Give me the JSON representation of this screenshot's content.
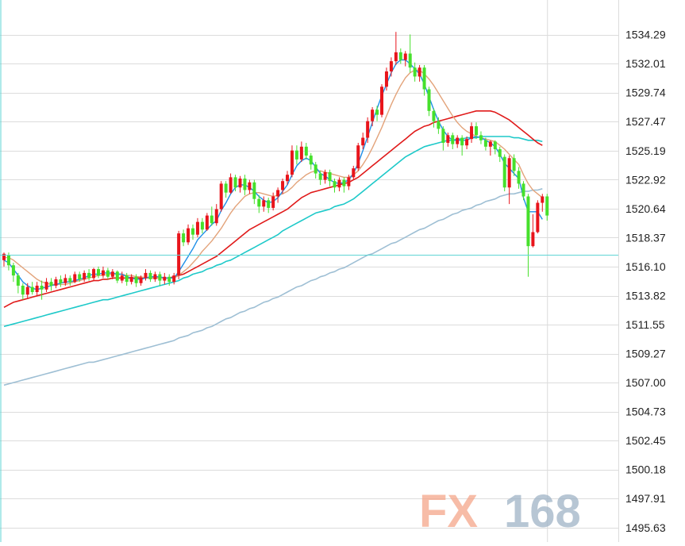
{
  "watermark": {
    "fx": "FX",
    "num": "168"
  },
  "colors": {
    "background": "#ffffff",
    "grid": "#dcdcdc",
    "axis_panel": "#ffffff",
    "up_candle": "#e8141b",
    "down_candle": "#46e02c",
    "ma_fast": "#1e8fe8",
    "ma_slow": "#e3a37a",
    "ma_mid": "#e01a1a",
    "ma_long": "#1ec9c9",
    "ma_longest": "#9ebfd4",
    "price_line": "#5fd5d5"
  },
  "chart_data": {
    "type": "candlestick",
    "title": "",
    "xlabel": "",
    "ylabel": "",
    "ylim": [
      1494.5,
      1537.0
    ],
    "grid": true,
    "y_ticks": [
      "1534.29",
      "1532.01",
      "1529.74",
      "1527.47",
      "1525.19",
      "1522.92",
      "1520.64",
      "1518.37",
      "1516.10",
      "1513.82",
      "1511.55",
      "1509.27",
      "1507.00",
      "1504.73",
      "1502.45",
      "1500.18",
      "1497.91",
      "1495.63"
    ],
    "current_price_line": 1517.0,
    "candles": [
      [
        1516.6,
        1517.1,
        1517.2,
        1516.1
      ],
      [
        1517.0,
        1516.2,
        1517.2,
        1515.8
      ],
      [
        1516.2,
        1515.4,
        1516.4,
        1514.9
      ],
      [
        1515.4,
        1514.6,
        1515.6,
        1514.0
      ],
      [
        1514.6,
        1513.9,
        1514.8,
        1513.5
      ],
      [
        1513.9,
        1514.5,
        1514.8,
        1513.6
      ],
      [
        1514.5,
        1514.1,
        1514.9,
        1513.9
      ],
      [
        1514.1,
        1514.6,
        1514.9,
        1513.8
      ],
      [
        1514.6,
        1514.3,
        1515.0,
        1513.5
      ],
      [
        1514.3,
        1514.9,
        1515.2,
        1514.1
      ],
      [
        1514.9,
        1514.6,
        1515.2,
        1514.2
      ],
      [
        1514.6,
        1515.1,
        1515.3,
        1514.4
      ],
      [
        1515.1,
        1514.8,
        1515.4,
        1514.5
      ],
      [
        1514.8,
        1515.2,
        1515.5,
        1514.6
      ],
      [
        1515.2,
        1514.9,
        1515.4,
        1514.6
      ],
      [
        1514.9,
        1515.5,
        1515.7,
        1514.8
      ],
      [
        1515.5,
        1515.1,
        1515.7,
        1514.9
      ],
      [
        1515.1,
        1515.6,
        1515.8,
        1514.9
      ],
      [
        1515.6,
        1515.2,
        1515.9,
        1515.0
      ],
      [
        1515.2,
        1515.9,
        1516.0,
        1515.0
      ],
      [
        1515.9,
        1515.4,
        1516.1,
        1515.2
      ],
      [
        1515.4,
        1515.8,
        1516.1,
        1515.2
      ],
      [
        1515.8,
        1515.3,
        1516.0,
        1515.1
      ],
      [
        1515.3,
        1515.7,
        1515.9,
        1515.1
      ],
      [
        1515.7,
        1515.0,
        1515.8,
        1514.8
      ],
      [
        1515.0,
        1515.4,
        1515.7,
        1514.8
      ],
      [
        1515.4,
        1514.9,
        1515.6,
        1514.6
      ],
      [
        1514.9,
        1515.3,
        1515.5,
        1514.7
      ],
      [
        1515.3,
        1514.8,
        1515.5,
        1514.5
      ],
      [
        1514.8,
        1515.2,
        1515.4,
        1514.6
      ],
      [
        1515.2,
        1515.6,
        1515.9,
        1515.0
      ],
      [
        1515.6,
        1515.1,
        1515.8,
        1514.9
      ],
      [
        1515.1,
        1515.5,
        1515.7,
        1514.9
      ],
      [
        1515.5,
        1515.0,
        1515.7,
        1514.6
      ],
      [
        1515.0,
        1515.3,
        1515.6,
        1514.7
      ],
      [
        1515.3,
        1514.9,
        1515.5,
        1514.6
      ],
      [
        1514.9,
        1515.4,
        1515.6,
        1514.7
      ],
      [
        1515.4,
        1518.7,
        1518.9,
        1515.1
      ],
      [
        1518.7,
        1518.0,
        1519.0,
        1517.7
      ],
      [
        1518.0,
        1519.1,
        1519.4,
        1517.8
      ],
      [
        1519.1,
        1518.6,
        1519.4,
        1518.2
      ],
      [
        1518.6,
        1519.6,
        1519.9,
        1518.4
      ],
      [
        1519.6,
        1519.0,
        1519.9,
        1518.7
      ],
      [
        1519.0,
        1520.1,
        1520.3,
        1518.9
      ],
      [
        1520.1,
        1519.5,
        1520.8,
        1519.3
      ],
      [
        1519.5,
        1520.6,
        1521.0,
        1519.3
      ],
      [
        1520.6,
        1522.6,
        1522.8,
        1520.4
      ],
      [
        1522.6,
        1521.9,
        1522.8,
        1521.5
      ],
      [
        1521.9,
        1523.1,
        1523.4,
        1521.8
      ],
      [
        1523.1,
        1522.3,
        1523.3,
        1522.0
      ],
      [
        1522.3,
        1523.0,
        1523.2,
        1521.9
      ],
      [
        1523.0,
        1522.1,
        1523.3,
        1521.7
      ],
      [
        1522.1,
        1522.7,
        1522.9,
        1521.8
      ],
      [
        1522.7,
        1521.4,
        1522.9,
        1521.0
      ],
      [
        1521.4,
        1520.8,
        1521.7,
        1520.3
      ],
      [
        1520.8,
        1521.3,
        1521.6,
        1520.4
      ],
      [
        1521.3,
        1520.7,
        1521.5,
        1520.3
      ],
      [
        1520.7,
        1521.6,
        1521.9,
        1520.5
      ],
      [
        1521.6,
        1522.1,
        1522.3,
        1521.1
      ],
      [
        1522.1,
        1522.8,
        1523.0,
        1521.8
      ],
      [
        1522.8,
        1523.3,
        1523.6,
        1522.5
      ],
      [
        1523.3,
        1525.2,
        1525.6,
        1523.1
      ],
      [
        1525.2,
        1524.5,
        1525.6,
        1524.1
      ],
      [
        1524.5,
        1525.5,
        1525.9,
        1524.3
      ],
      [
        1525.5,
        1524.8,
        1525.8,
        1524.5
      ],
      [
        1524.8,
        1524.1,
        1525.0,
        1523.7
      ],
      [
        1524.1,
        1523.4,
        1524.3,
        1523.0
      ],
      [
        1523.4,
        1522.9,
        1523.6,
        1522.5
      ],
      [
        1522.9,
        1523.5,
        1523.7,
        1522.6
      ],
      [
        1523.5,
        1522.8,
        1523.7,
        1522.4
      ],
      [
        1522.8,
        1522.3,
        1523.0,
        1521.9
      ],
      [
        1522.3,
        1522.9,
        1523.1,
        1522.0
      ],
      [
        1522.9,
        1522.4,
        1523.1,
        1521.9
      ],
      [
        1522.4,
        1523.1,
        1523.3,
        1522.1
      ],
      [
        1523.1,
        1523.8,
        1524.0,
        1522.9
      ],
      [
        1523.8,
        1525.6,
        1525.8,
        1523.6
      ],
      [
        1525.6,
        1526.2,
        1526.6,
        1525.3
      ],
      [
        1526.2,
        1527.5,
        1527.8,
        1525.8
      ],
      [
        1527.5,
        1528.4,
        1528.6,
        1527.1
      ],
      [
        1528.4,
        1528.0,
        1528.7,
        1527.5
      ],
      [
        1528.0,
        1530.2,
        1530.4,
        1527.8
      ],
      [
        1530.2,
        1531.4,
        1531.7,
        1529.9
      ],
      [
        1531.4,
        1532.2,
        1532.5,
        1531.0
      ],
      [
        1532.2,
        1532.9,
        1534.5,
        1531.9
      ],
      [
        1532.9,
        1532.3,
        1533.2,
        1532.0
      ],
      [
        1532.3,
        1532.8,
        1533.0,
        1531.8
      ],
      [
        1532.8,
        1531.7,
        1534.3,
        1531.3
      ],
      [
        1531.7,
        1531.0,
        1532.1,
        1530.6
      ],
      [
        1531.0,
        1531.7,
        1531.9,
        1530.6
      ],
      [
        1531.7,
        1530.0,
        1531.9,
        1529.5
      ],
      [
        1530.0,
        1528.3,
        1530.2,
        1527.9
      ],
      [
        1528.3,
        1527.5,
        1528.5,
        1527.0
      ],
      [
        1527.5,
        1526.9,
        1527.8,
        1526.5
      ],
      [
        1526.9,
        1525.8,
        1527.1,
        1525.2
      ],
      [
        1525.8,
        1526.4,
        1526.6,
        1525.5
      ],
      [
        1526.4,
        1525.7,
        1526.6,
        1525.3
      ],
      [
        1525.7,
        1526.2,
        1526.4,
        1525.4
      ],
      [
        1526.2,
        1525.6,
        1526.4,
        1524.8
      ],
      [
        1525.6,
        1526.1,
        1526.3,
        1525.3
      ],
      [
        1526.1,
        1527.1,
        1527.4,
        1525.8
      ],
      [
        1527.1,
        1526.4,
        1527.4,
        1526.1
      ],
      [
        1526.4,
        1526.0,
        1526.7,
        1525.7
      ],
      [
        1526.0,
        1525.5,
        1526.2,
        1525.2
      ],
      [
        1525.5,
        1525.9,
        1526.0,
        1524.8
      ],
      [
        1525.9,
        1525.3,
        1526.0,
        1524.9
      ],
      [
        1525.3,
        1524.7,
        1525.5,
        1524.3
      ],
      [
        1524.7,
        1522.3,
        1524.9,
        1522.0
      ],
      [
        1522.3,
        1524.6,
        1524.8,
        1521.0
      ],
      [
        1524.6,
        1523.6,
        1524.9,
        1523.2
      ],
      [
        1523.6,
        1522.6,
        1523.9,
        1522.2
      ],
      [
        1522.6,
        1521.6,
        1522.8,
        1521.3
      ],
      [
        1521.6,
        1517.7,
        1521.8,
        1515.3
      ],
      [
        1517.7,
        1518.8,
        1520.2,
        1517.6
      ],
      [
        1518.8,
        1521.1,
        1521.3,
        1518.7
      ],
      [
        1521.1,
        1521.6,
        1521.8,
        1520.4
      ],
      [
        1521.6,
        1520.1,
        1521.8,
        1519.7
      ]
    ],
    "ma_fast": [
      1516.6,
      1516.4,
      1515.9,
      1515.4,
      1514.9,
      1514.6,
      1514.4,
      1514.3,
      1514.4,
      1514.5,
      1514.6,
      1514.7,
      1514.8,
      1514.9,
      1514.9,
      1515.0,
      1515.1,
      1515.2,
      1515.4,
      1515.5,
      1515.5,
      1515.6,
      1515.6,
      1515.6,
      1515.5,
      1515.5,
      1515.3,
      1515.2,
      1515.1,
      1515.1,
      1515.2,
      1515.3,
      1515.3,
      1515.3,
      1515.2,
      1515.2,
      1515.2,
      1515.7,
      1516.3,
      1516.9,
      1517.5,
      1518.2,
      1518.6,
      1519.0,
      1519.4,
      1519.7,
      1520.5,
      1521.1,
      1521.8,
      1522.3,
      1522.5,
      1522.5,
      1522.3,
      1522.0,
      1521.6,
      1521.3,
      1521.1,
      1521.2,
      1521.5,
      1522.0,
      1522.5,
      1523.3,
      1524.0,
      1524.4,
      1524.6,
      1524.4,
      1523.9,
      1523.4,
      1523.2,
      1522.9,
      1522.7,
      1522.6,
      1522.7,
      1522.9,
      1523.4,
      1524.2,
      1525.2,
      1526.3,
      1527.4,
      1528.5,
      1529.5,
      1530.4,
      1531.3,
      1532.0,
      1532.3,
      1532.3,
      1532.0,
      1531.6,
      1531.2,
      1530.4,
      1529.4,
      1528.4,
      1527.5,
      1526.8,
      1526.3,
      1526.0,
      1526.0,
      1526.0,
      1526.0,
      1526.2,
      1526.3,
      1526.2,
      1526.0,
      1525.8,
      1525.5,
      1524.9,
      1524.2,
      1523.8,
      1523.4,
      1523.0,
      1521.5,
      1520.4,
      1520.4,
      1520.4,
      1519.8
    ],
    "ma_slow": [
      1516.8,
      1516.8,
      1516.6,
      1516.3,
      1516.0,
      1515.7,
      1515.4,
      1515.1,
      1514.9,
      1514.8,
      1514.7,
      1514.7,
      1514.7,
      1514.7,
      1514.8,
      1514.9,
      1515.0,
      1515.1,
      1515.2,
      1515.3,
      1515.4,
      1515.4,
      1515.5,
      1515.5,
      1515.5,
      1515.5,
      1515.4,
      1515.4,
      1515.3,
      1515.3,
      1515.2,
      1515.2,
      1515.2,
      1515.2,
      1515.2,
      1515.2,
      1515.2,
      1515.4,
      1515.7,
      1516.0,
      1516.4,
      1516.8,
      1517.3,
      1517.7,
      1518.1,
      1518.6,
      1519.1,
      1519.7,
      1520.3,
      1520.8,
      1521.2,
      1521.6,
      1521.8,
      1521.9,
      1521.9,
      1521.8,
      1521.7,
      1521.6,
      1521.7,
      1521.8,
      1522.0,
      1522.3,
      1522.7,
      1523.0,
      1523.3,
      1523.5,
      1523.6,
      1523.6,
      1523.5,
      1523.4,
      1523.3,
      1523.2,
      1523.1,
      1523.1,
      1523.3,
      1523.6,
      1524.1,
      1524.7,
      1525.4,
      1526.2,
      1527.0,
      1527.9,
      1528.8,
      1529.6,
      1530.3,
      1530.9,
      1531.3,
      1531.5,
      1531.5,
      1531.2,
      1530.8,
      1530.3,
      1529.7,
      1529.1,
      1528.5,
      1527.9,
      1527.4,
      1527.0,
      1526.7,
      1526.5,
      1526.3,
      1526.2,
      1526.1,
      1526.0,
      1525.9,
      1525.6,
      1525.3,
      1524.9,
      1524.5,
      1524.1,
      1523.3,
      1522.6,
      1522.1,
      1521.8,
      1521.5
    ],
    "ma_mid": [
      1512.9,
      1513.1,
      1513.3,
      1513.4,
      1513.5,
      1513.6,
      1513.7,
      1513.8,
      1513.9,
      1514.0,
      1514.1,
      1514.2,
      1514.3,
      1514.4,
      1514.5,
      1514.6,
      1514.7,
      1514.8,
      1514.9,
      1515.0,
      1515.0,
      1515.1,
      1515.1,
      1515.2,
      1515.2,
      1515.2,
      1515.2,
      1515.2,
      1515.2,
      1515.2,
      1515.2,
      1515.2,
      1515.2,
      1515.2,
      1515.2,
      1515.2,
      1515.3,
      1515.4,
      1515.5,
      1515.7,
      1515.9,
      1516.1,
      1516.3,
      1516.5,
      1516.7,
      1516.9,
      1517.2,
      1517.5,
      1517.8,
      1518.1,
      1518.4,
      1518.7,
      1519.0,
      1519.2,
      1519.4,
      1519.6,
      1519.8,
      1520.0,
      1520.2,
      1520.4,
      1520.6,
      1520.9,
      1521.2,
      1521.5,
      1521.7,
      1521.9,
      1522.0,
      1522.1,
      1522.2,
      1522.3,
      1522.4,
      1522.5,
      1522.6,
      1522.7,
      1522.9,
      1523.1,
      1523.4,
      1523.7,
      1524.0,
      1524.3,
      1524.6,
      1524.9,
      1525.2,
      1525.5,
      1525.8,
      1526.1,
      1526.4,
      1526.7,
      1526.9,
      1527.1,
      1527.2,
      1527.4,
      1527.5,
      1527.6,
      1527.7,
      1527.8,
      1527.9,
      1528.0,
      1528.1,
      1528.2,
      1528.3,
      1528.3,
      1528.3,
      1528.3,
      1528.2,
      1528.0,
      1527.8,
      1527.6,
      1527.3,
      1527.0,
      1526.7,
      1526.4,
      1526.1,
      1525.8,
      1525.6
    ],
    "ma_long": [
      1511.4,
      1511.5,
      1511.6,
      1511.7,
      1511.8,
      1511.9,
      1512.0,
      1512.1,
      1512.2,
      1512.3,
      1512.4,
      1512.5,
      1512.6,
      1512.7,
      1512.8,
      1512.9,
      1513.0,
      1513.1,
      1513.2,
      1513.3,
      1513.4,
      1513.5,
      1513.5,
      1513.6,
      1513.7,
      1513.8,
      1513.9,
      1514.0,
      1514.1,
      1514.2,
      1514.3,
      1514.4,
      1514.5,
      1514.6,
      1514.7,
      1514.8,
      1514.9,
      1515.0,
      1515.2,
      1515.3,
      1515.5,
      1515.6,
      1515.7,
      1515.9,
      1516.0,
      1516.2,
      1516.3,
      1516.5,
      1516.6,
      1516.8,
      1517.0,
      1517.2,
      1517.4,
      1517.6,
      1517.8,
      1518.0,
      1518.2,
      1518.4,
      1518.6,
      1518.9,
      1519.1,
      1519.3,
      1519.5,
      1519.7,
      1519.9,
      1520.1,
      1520.3,
      1520.4,
      1520.5,
      1520.6,
      1520.8,
      1520.9,
      1521.0,
      1521.2,
      1521.4,
      1521.7,
      1522.0,
      1522.3,
      1522.6,
      1522.9,
      1523.2,
      1523.5,
      1523.8,
      1524.1,
      1524.4,
      1524.7,
      1524.9,
      1525.1,
      1525.3,
      1525.5,
      1525.6,
      1525.7,
      1525.8,
      1525.9,
      1526.0,
      1526.0,
      1526.1,
      1526.1,
      1526.2,
      1526.2,
      1526.2,
      1526.3,
      1526.3,
      1526.3,
      1526.3,
      1526.3,
      1526.3,
      1526.3,
      1526.2,
      1526.2,
      1526.1,
      1526.0,
      1526.0,
      1526.0,
      1525.9
    ],
    "ma_longest": [
      1506.8,
      1506.9,
      1507.0,
      1507.1,
      1507.2,
      1507.3,
      1507.4,
      1507.5,
      1507.6,
      1507.7,
      1507.8,
      1507.9,
      1508.0,
      1508.1,
      1508.2,
      1508.3,
      1508.4,
      1508.5,
      1508.6,
      1508.6,
      1508.7,
      1508.8,
      1508.9,
      1509.0,
      1509.1,
      1509.2,
      1509.3,
      1509.4,
      1509.5,
      1509.6,
      1509.7,
      1509.8,
      1509.9,
      1510.0,
      1510.1,
      1510.2,
      1510.3,
      1510.5,
      1510.6,
      1510.7,
      1510.9,
      1511.0,
      1511.1,
      1511.3,
      1511.4,
      1511.6,
      1511.8,
      1512.0,
      1512.1,
      1512.3,
      1512.5,
      1512.6,
      1512.8,
      1512.9,
      1513.1,
      1513.3,
      1513.4,
      1513.6,
      1513.7,
      1513.9,
      1514.1,
      1514.3,
      1514.5,
      1514.6,
      1514.8,
      1515.0,
      1515.1,
      1515.3,
      1515.4,
      1515.6,
      1515.7,
      1515.9,
      1516.0,
      1516.2,
      1516.4,
      1516.6,
      1516.8,
      1517.0,
      1517.1,
      1517.3,
      1517.5,
      1517.7,
      1517.9,
      1518.0,
      1518.2,
      1518.4,
      1518.6,
      1518.8,
      1519.0,
      1519.1,
      1519.3,
      1519.5,
      1519.7,
      1519.8,
      1520.0,
      1520.2,
      1520.3,
      1520.5,
      1520.6,
      1520.7,
      1520.9,
      1521.0,
      1521.2,
      1521.3,
      1521.4,
      1521.6,
      1521.7,
      1521.8,
      1521.8,
      1521.9,
      1522.0,
      1522.0,
      1522.1,
      1522.1,
      1522.2
    ]
  }
}
